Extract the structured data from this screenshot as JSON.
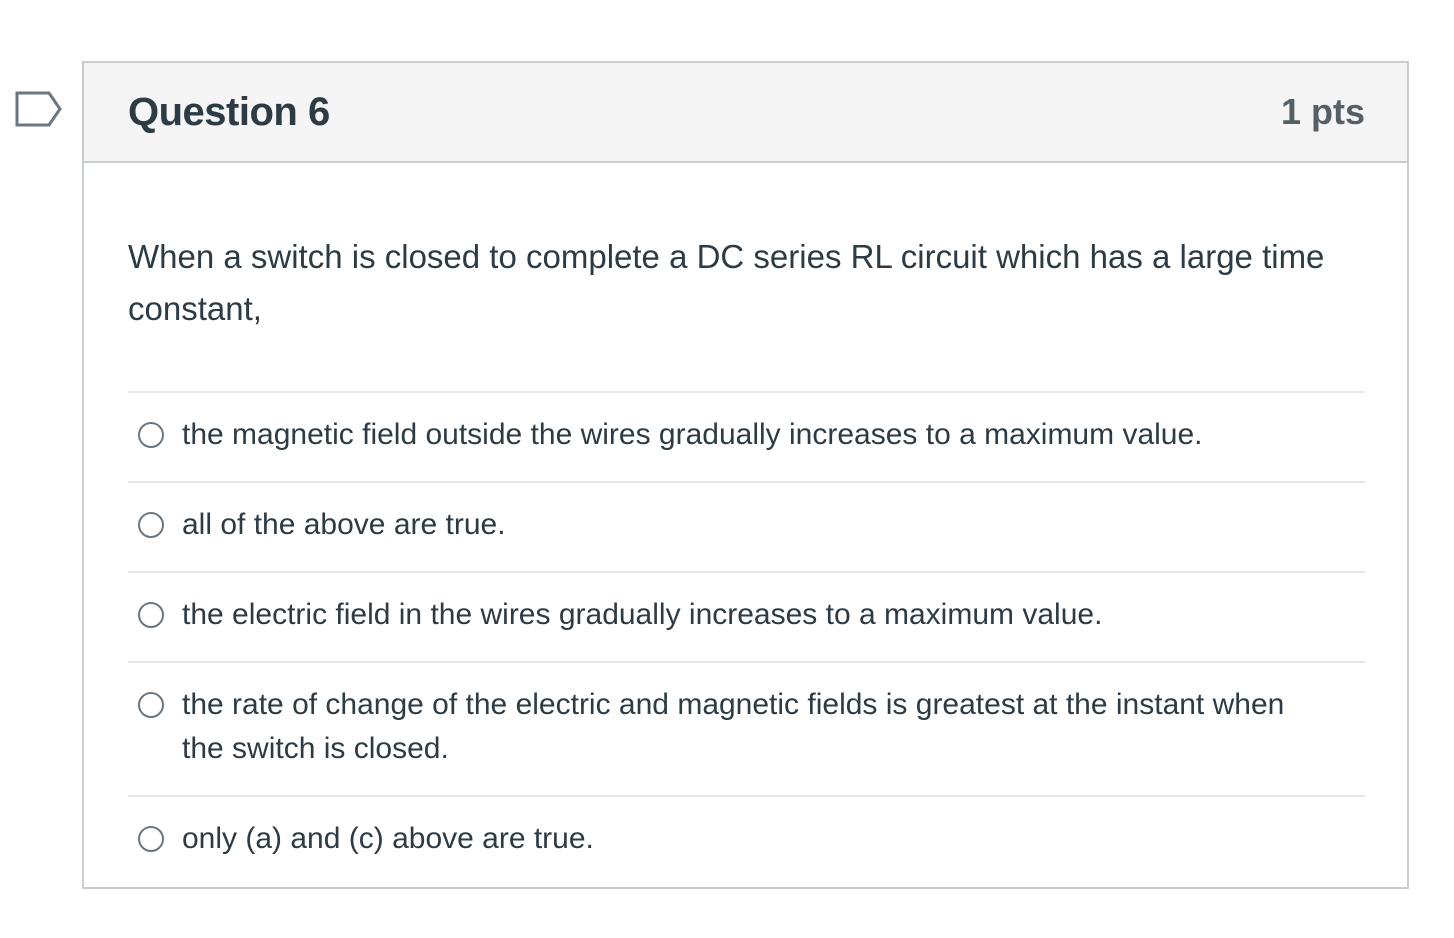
{
  "flag": {
    "icon": "flag-question-icon"
  },
  "question": {
    "title": "Question 6",
    "points": "1 pts",
    "text": "When a switch is closed to complete a DC series RL circuit which has a large time constant,"
  },
  "answers": [
    {
      "label": "the magnetic field outside the wires gradually increases to a maximum value.",
      "selected": false
    },
    {
      "label": "all of the above are true.",
      "selected": false
    },
    {
      "label": "the electric field in the wires gradually increases to a maximum value.",
      "selected": false
    },
    {
      "label": "the rate of change of the electric and magnetic fields is greatest at the instant when the switch is closed.",
      "selected": false
    },
    {
      "label": "only (a) and (c) above are true.",
      "selected": false
    }
  ],
  "colors": {
    "header_bg": "#f5f5f5",
    "border": "#c7cdd1",
    "text": "#2d3b45",
    "flag_stroke": "#6b7780"
  }
}
